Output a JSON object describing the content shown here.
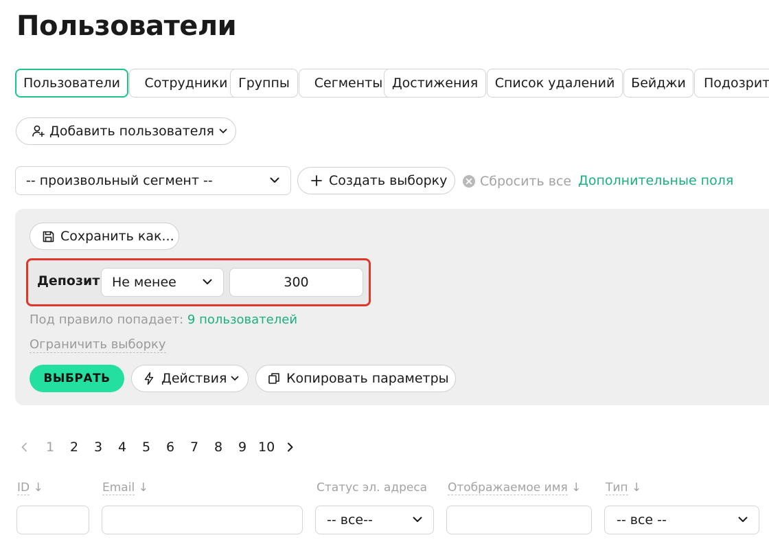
{
  "page": {
    "title": "Пользователи"
  },
  "tabs": [
    {
      "label": "Пользователи",
      "active": true
    },
    {
      "label": "Сотрудники"
    },
    {
      "label": "Группы"
    },
    {
      "label": "Сегменты"
    },
    {
      "label": "Достижения"
    },
    {
      "label": "Список удалений"
    },
    {
      "label": "Бейджи"
    },
    {
      "label": "Подозрит"
    }
  ],
  "toolbar": {
    "add_user_label": "Добавить пользователя",
    "segment_select_value": "-- произвольный сегмент --",
    "create_selection_label": "Создать выборку",
    "reset_all_label": "Сбросить все",
    "extra_fields_label": "Дополнительные поля"
  },
  "filter_panel": {
    "save_as_label": "Сохранить как...",
    "rule": {
      "field_label": "Депозит",
      "operator_value": "Не менее",
      "value": "300"
    },
    "match_prefix": "Под правило попадает:",
    "match_count_link": "9 пользователей",
    "limit_label": "Ограничить выборку",
    "select_button": "ВЫБРАТЬ",
    "actions_label": "Действия",
    "copy_params_label": "Копировать параметры"
  },
  "pagination": {
    "current": "1",
    "pages": [
      "2",
      "3",
      "4",
      "5",
      "6",
      "7",
      "8",
      "9",
      "10"
    ]
  },
  "table": {
    "columns": [
      {
        "label": "ID",
        "sort": "↓"
      },
      {
        "label": "Email",
        "sort": "↓"
      },
      {
        "label": "Статус эл. адреса",
        "sort": ""
      },
      {
        "label": "Отображаемое имя",
        "sort": "↓"
      },
      {
        "label": "Тип",
        "sort": "↓"
      }
    ],
    "filters": {
      "status_value": "-- все--",
      "type_value": "-- все --"
    }
  },
  "colors": {
    "accent": "#1ec28b",
    "primary_button": "#24e0a0",
    "highlight_border": "#e0362c",
    "panel_bg": "#efefef"
  }
}
